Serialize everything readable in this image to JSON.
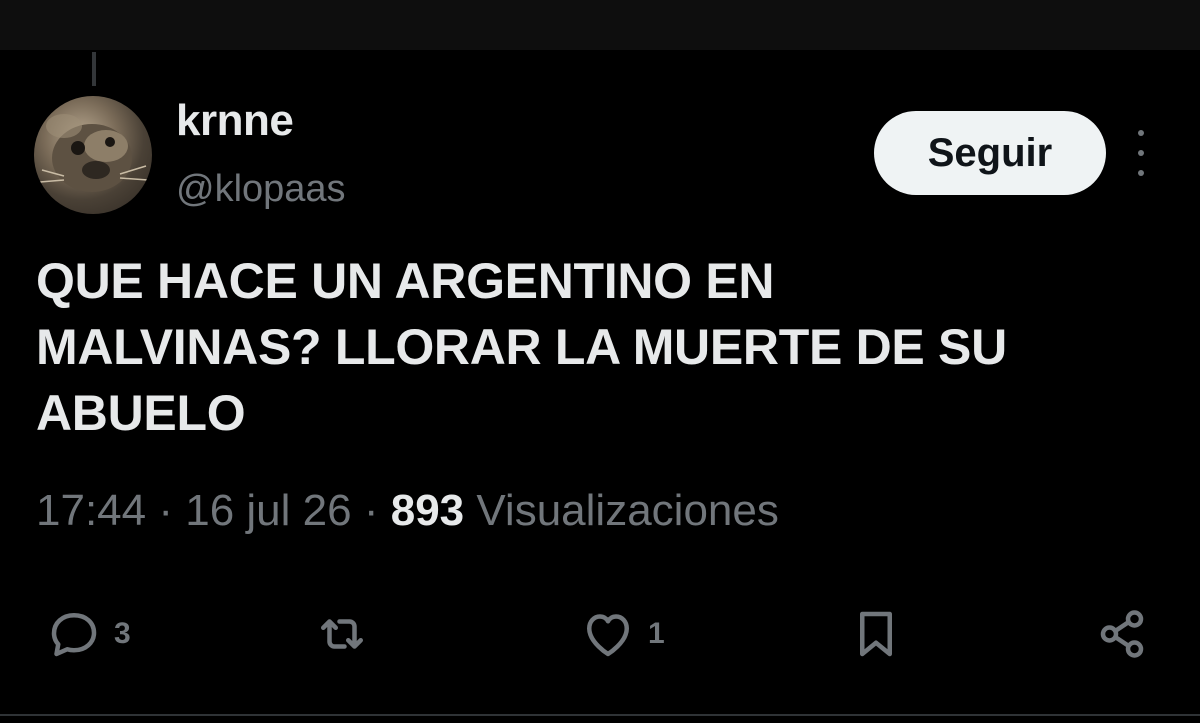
{
  "tweet": {
    "author": {
      "display_name": "krnne",
      "handle": "@klopaas"
    },
    "follow_label": "Seguir",
    "text_lines": [
      "QUE HACE UN ARGENTINO EN",
      "MALVINAS? LLORAR LA MUERTE DE SU",
      "ABUELO"
    ],
    "time": "17:44",
    "separator": "·",
    "date": "16 jul 26",
    "views_count": "893",
    "views_label": "Visualizaciones"
  },
  "actions": {
    "reply": {
      "icon": "reply-icon",
      "count": "3"
    },
    "retweet": {
      "icon": "retweet-icon",
      "count": ""
    },
    "like": {
      "icon": "heart-icon",
      "count": "1"
    },
    "bookmark": {
      "icon": "bookmark-icon",
      "count": ""
    },
    "share": {
      "icon": "share-icon",
      "count": ""
    }
  },
  "colors": {
    "background": "#000000",
    "text_primary": "#e7e9ea",
    "text_secondary": "#71767b",
    "follow_button_bg": "#eff3f4"
  }
}
